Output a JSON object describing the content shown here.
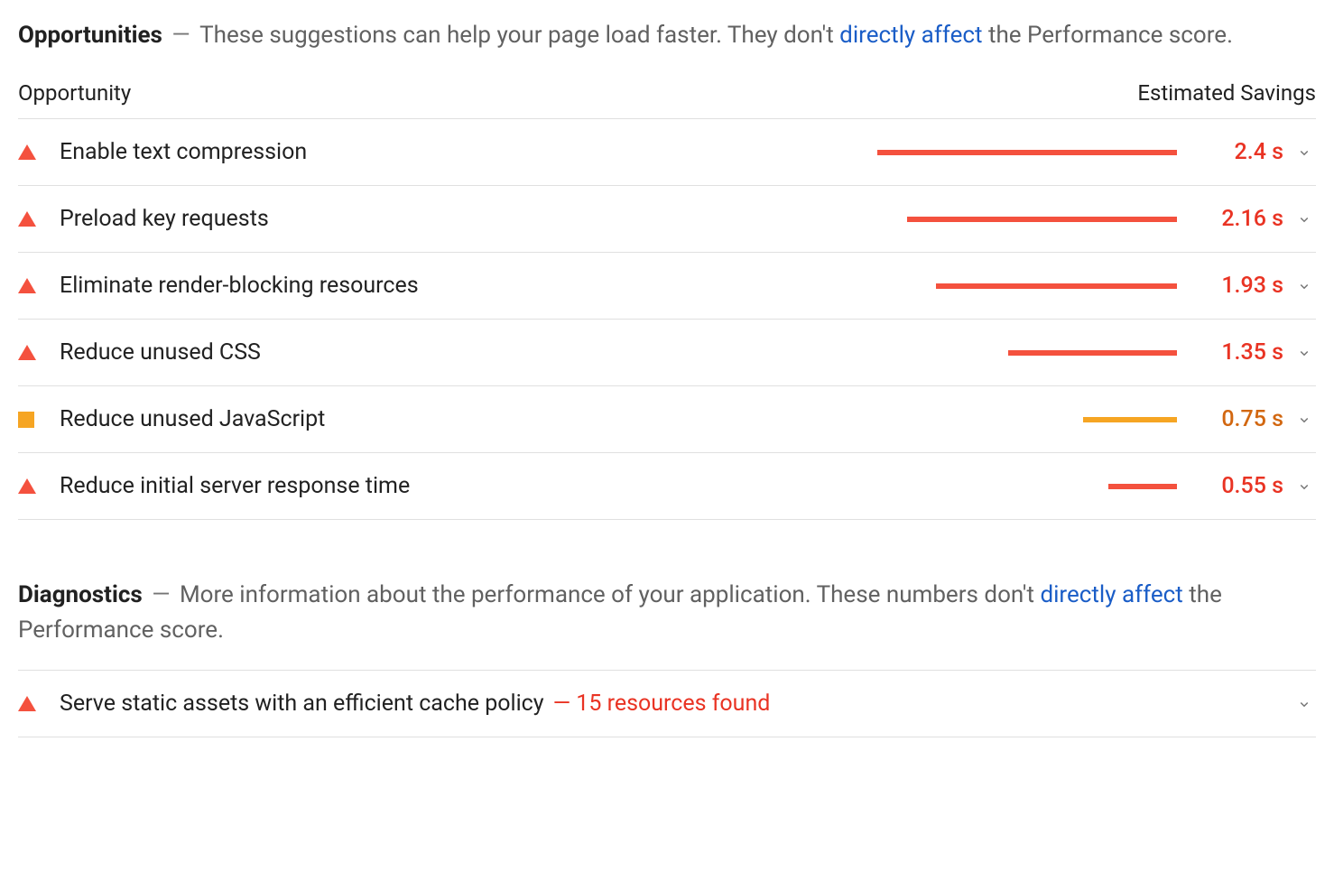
{
  "opportunities": {
    "title": "Opportunities",
    "desc_prefix": "These suggestions can help your page load faster. They don't ",
    "desc_link": "directly affect",
    "desc_suffix": " the Performance score.",
    "col_left": "Opportunity",
    "col_right": "Estimated Savings",
    "bar_max_seconds": 2.6,
    "items": [
      {
        "title": "Enable text compression",
        "savings": "2.4 s",
        "seconds": 2.4,
        "severity": "red"
      },
      {
        "title": "Preload key requests",
        "savings": "2.16 s",
        "seconds": 2.16,
        "severity": "red"
      },
      {
        "title": "Eliminate render-blocking resources",
        "savings": "1.93 s",
        "seconds": 1.93,
        "severity": "red"
      },
      {
        "title": "Reduce unused CSS",
        "savings": "1.35 s",
        "seconds": 1.35,
        "severity": "red"
      },
      {
        "title": "Reduce unused JavaScript",
        "savings": "0.75 s",
        "seconds": 0.75,
        "severity": "orange"
      },
      {
        "title": "Reduce initial server response time",
        "savings": "0.55 s",
        "seconds": 0.55,
        "severity": "red"
      }
    ]
  },
  "diagnostics": {
    "title": "Diagnostics",
    "desc_prefix": "More information about the performance of your application. These numbers don't ",
    "desc_link": "directly affect",
    "desc_suffix": " the Performance score.",
    "items": [
      {
        "title": "Serve static assets with an efficient cache policy",
        "detail": "15 resources found",
        "severity": "red"
      }
    ]
  }
}
